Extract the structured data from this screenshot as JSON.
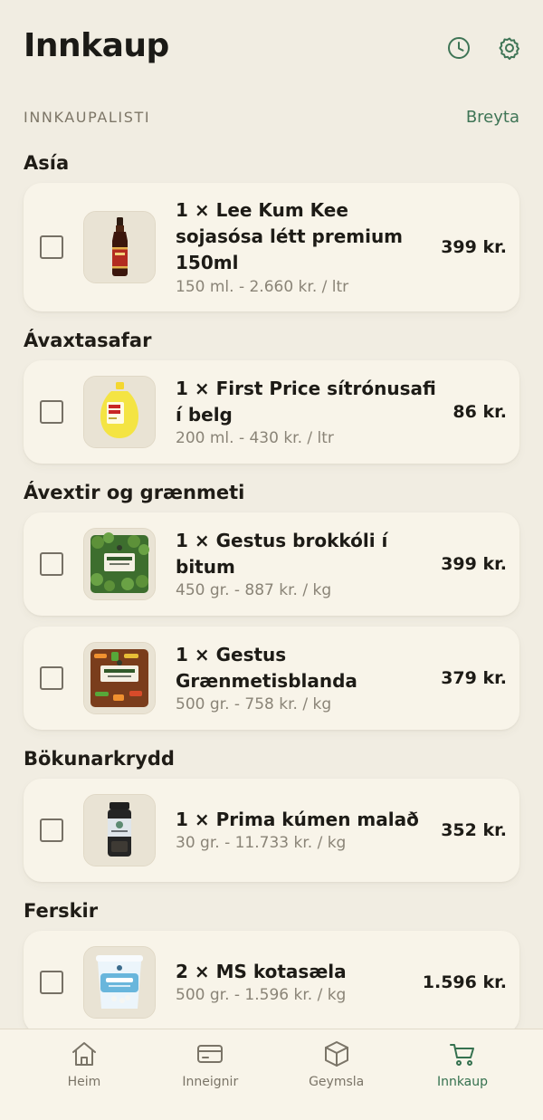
{
  "header": {
    "title": "Innkaup",
    "history_icon": "clock-icon",
    "settings_icon": "gear-icon"
  },
  "list": {
    "label": "INNKAUPALISTI",
    "edit_label": "Breyta"
  },
  "categories": [
    {
      "title": "Asía",
      "items": [
        {
          "name": "1 × Lee Kum Kee sojasósa létt premium 150ml",
          "meta": "150 ml. - 2.660 kr. / ltr",
          "price": "399 kr.",
          "thumbnail_icon": "soy-sauce-bottle-image"
        }
      ]
    },
    {
      "title": "Ávaxtasafar",
      "items": [
        {
          "name": "1 × First Price sítrónusafi í belg",
          "meta": "200 ml. - 430 kr. / ltr",
          "price": "86 kr.",
          "thumbnail_icon": "lemon-juice-bottle-image"
        }
      ]
    },
    {
      "title": "Ávextir og grænmeti",
      "items": [
        {
          "name": "1 × Gestus brokkóli í bitum",
          "meta": "450 gr. - 887 kr. / kg",
          "price": "399 kr.",
          "thumbnail_icon": "broccoli-bag-image"
        },
        {
          "name": "1 × Gestus Grænmetisblanda",
          "meta": "500 gr. - 758 kr. / kg",
          "price": "379 kr.",
          "thumbnail_icon": "vegetable-mix-bag-image"
        }
      ]
    },
    {
      "title": "Bökunarkrydd",
      "items": [
        {
          "name": "1 × Prima kúmen malað",
          "meta": "30 gr. - 11.733 kr. / kg",
          "price": "352 kr.",
          "thumbnail_icon": "spice-jar-image"
        }
      ]
    },
    {
      "title": "Ferskir",
      "items": [
        {
          "name": "2 × MS kotasæla",
          "meta": "500 gr. - 1.596 kr. / kg",
          "price": "1.596 kr.",
          "thumbnail_icon": "cottage-cheese-tub-image"
        }
      ]
    }
  ],
  "nav": {
    "items": [
      {
        "label": "Heim",
        "icon": "home-icon",
        "active": false
      },
      {
        "label": "Inneignir",
        "icon": "credit-card-icon",
        "active": false
      },
      {
        "label": "Geymsla",
        "icon": "box-icon",
        "active": false
      },
      {
        "label": "Innkaup",
        "icon": "cart-icon",
        "active": true
      }
    ]
  },
  "colors": {
    "background": "#f1ede2",
    "card": "#f8f4e9",
    "accent_green": "#3f7556",
    "text_primary": "#1d1b16",
    "text_secondary": "#8a8477"
  }
}
